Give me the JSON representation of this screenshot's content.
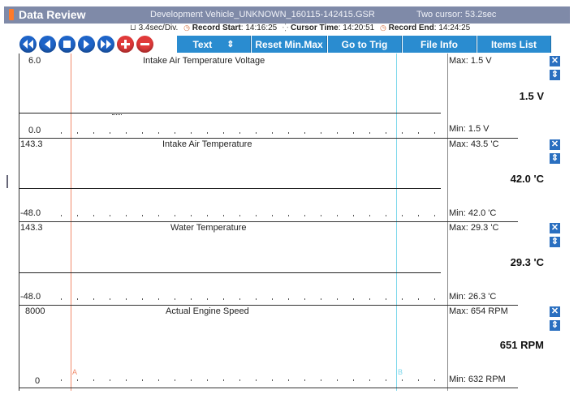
{
  "titlebar": {
    "app_title": "Data Review",
    "file": "Development Vehicle_UNKNOWN_160115-142415.GSR",
    "cursor": "Two cursor: 53.2sec"
  },
  "infobar": {
    "div": "3.4sec/Div.",
    "record_start_label": "Record Start",
    "record_start": " : 14:16:25",
    "cursor_time_label": "Cursor Time",
    "cursor_time": " : 14:20:51",
    "record_end_label": "Record End",
    "record_end": " : 14:24:25"
  },
  "toolbar": {
    "text_label": "Text",
    "text_arrow": "⇕",
    "reset_label": "Reset Min.Max",
    "trig_label": "Go to Trig",
    "fileinfo_label": "File Info",
    "items_label": "Items List"
  },
  "icons": {
    "first": "◀◀",
    "prev": "◀",
    "stop": "■",
    "play": "▶",
    "next": "▶▶",
    "add": "+",
    "remove": "−",
    "close": "✕",
    "scroll": "⇕"
  },
  "colors": {
    "cursorA": "#f08a6a",
    "cursorB": "#7fd8ec"
  },
  "channels": [
    {
      "title": "Intake Air Temperature Voltage",
      "top_value": "6.0",
      "bottom_value": "0.0",
      "max": "Max:   1.5 V",
      "min": "Min:    1.5 V",
      "current": "1.5 V"
    },
    {
      "title": "Intake Air Temperature",
      "top_value": "143.3",
      "bottom_value": "-48.0",
      "max": "Max:  43.5 'C",
      "min": "Min:  42.0 'C",
      "current": "42.0 'C"
    },
    {
      "title": "Water Temperature",
      "top_value": "143.3",
      "bottom_value": "-48.0",
      "max": "Max:  29.3 'C",
      "min": "Min:  26.3 'C",
      "current": "29.3 'C"
    },
    {
      "title": "Actual Engine Speed",
      "top_value": "8000",
      "bottom_value": "0",
      "max": "Max:   654 RPM",
      "min": "Min:    632 RPM",
      "current": "651 RPM"
    }
  ],
  "cursor_labels": {
    "a": "A",
    "b": "B"
  }
}
